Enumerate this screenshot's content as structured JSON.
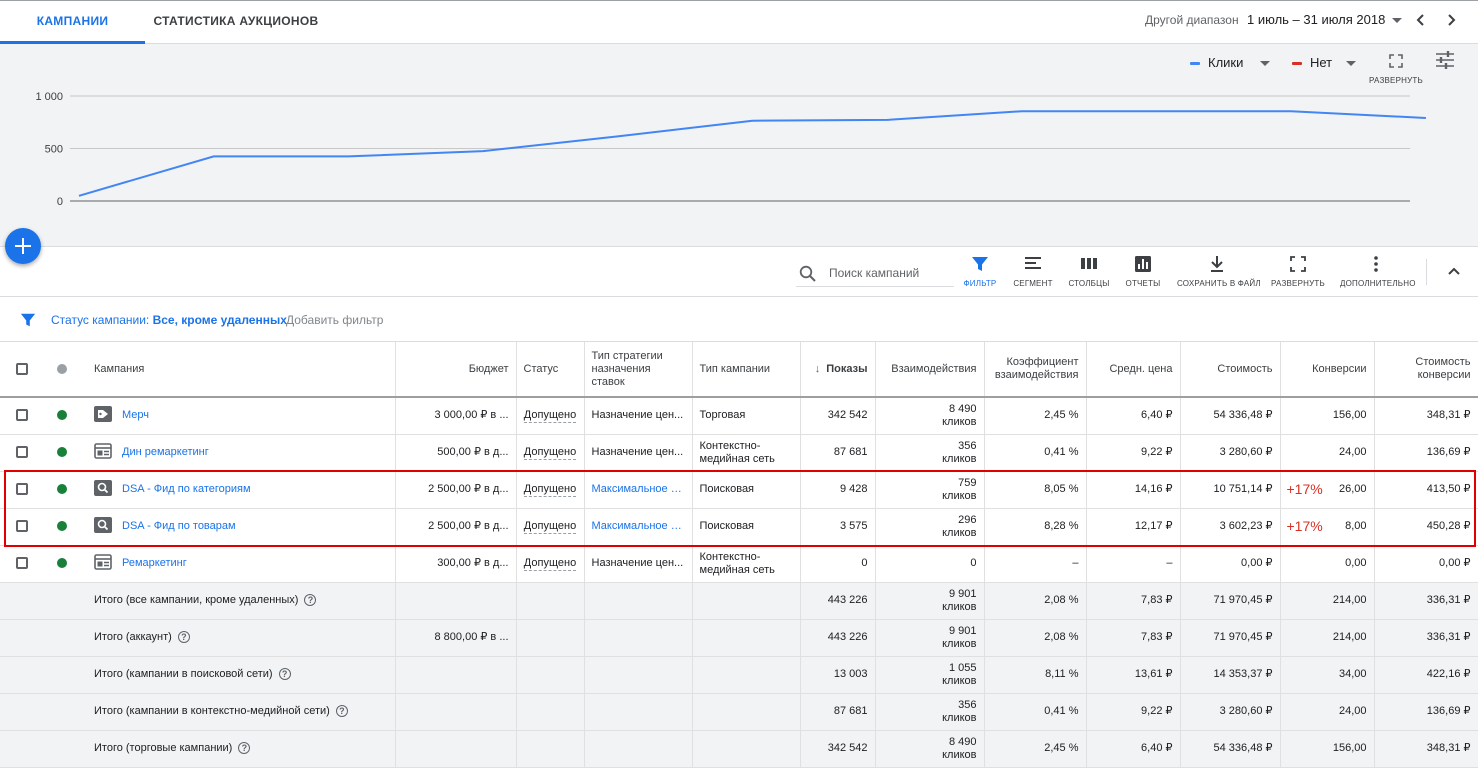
{
  "tabs": [
    {
      "label": "КАМПАНИИ",
      "active": true
    },
    {
      "label": "СТАТИСТИКА АУКЦИОНОВ",
      "active": false
    }
  ],
  "date_range": {
    "label": "Другой диапазон",
    "value": "1 июль – 31 июля 2018"
  },
  "chart_controls": {
    "metric1": {
      "label": "Клики",
      "color": "#4285f4"
    },
    "metric2": {
      "label": "Нет",
      "color": "#d93025"
    },
    "expand_label": "РАЗВЕРНУТЬ"
  },
  "chart_data": {
    "type": "line",
    "series": [
      {
        "values": [
          50,
          425,
          425,
          475,
          615,
          765,
          772,
          855,
          855,
          855,
          790
        ]
      }
    ],
    "y_ticks": [
      "1 000",
      "500",
      "0"
    ],
    "ylim": [
      0,
      1000
    ],
    "grid": true,
    "color": "#4285f4"
  },
  "toolbar": {
    "search_placeholder": "Поиск кампаний",
    "tools": {
      "filter": "ФИЛЬТР",
      "segment": "СЕГМЕНТ",
      "columns": "СТОЛБЦЫ",
      "reports": "ОТЧЕТЫ",
      "download": "СОХРАНИТЬ В ФАЙЛ",
      "expand": "РАЗВЕРНУТЬ",
      "more": "ДОПОЛНИТЕЛЬНО"
    }
  },
  "filter": {
    "prefix": "Статус кампании: ",
    "value": "Все, кроме удаленных",
    "add_label": "Добавить фильтр"
  },
  "table": {
    "headers": {
      "campaign": "Кампания",
      "budget": "Бюджет",
      "status": "Статус",
      "strategy": "Тип стратегии назначения ставок",
      "type": "Тип кампании",
      "impressions": "Показы",
      "interactions": "Взаимодействия",
      "rate": "Коэффициент взаимодействия",
      "avg_cost": "Средн. цена",
      "cost": "Стоимость",
      "conversions": "Конверсии",
      "conv_cost": "Стоимость конверсии"
    },
    "rows": [
      {
        "name": "Мерч",
        "icon": "tag-icon",
        "budget": "3 000,00 ₽ в ...",
        "status": "Допущено",
        "strategy": "Назначение цен...",
        "type": "Торговая",
        "impressions": "342 542",
        "interactions": "8 490",
        "interactions_unit": "кликов",
        "rate": "2,45 %",
        "avg_cost": "6,40 ₽",
        "cost": "54 336,48 ₽",
        "change": "",
        "conversions": "156,00",
        "conv_cost": "348,31 ₽"
      },
      {
        "name": "Дин ремаркетинг",
        "icon": "display-icon",
        "budget": "500,00 ₽ в д...",
        "status": "Допущено",
        "strategy": "Назначение цен...",
        "type": "Контекстно-медийная сеть",
        "impressions": "87 681",
        "interactions": "356",
        "interactions_unit": "кликов",
        "rate": "0,41 %",
        "avg_cost": "9,22 ₽",
        "cost": "3 280,60 ₽",
        "change": "",
        "conversions": "24,00",
        "conv_cost": "136,69 ₽"
      },
      {
        "name": "DSA - Фид по категориям",
        "icon": "search-campaign-icon",
        "budget": "2 500,00 ₽ в д...",
        "status": "Допущено",
        "strategy": "Максимальное к...",
        "type": "Поисковая",
        "impressions": "9 428",
        "interactions": "759",
        "interactions_unit": "кликов",
        "rate": "8,05 %",
        "avg_cost": "14,16 ₽",
        "cost": "10 751,14 ₽",
        "change": "+17%",
        "conversions": "26,00",
        "conv_cost": "413,50 ₽"
      },
      {
        "name": "DSA - Фид по товарам",
        "icon": "search-campaign-icon",
        "budget": "2 500,00 ₽ в д...",
        "status": "Допущено",
        "strategy": "Максимальное к...",
        "type": "Поисковая",
        "impressions": "3 575",
        "interactions": "296",
        "interactions_unit": "кликов",
        "rate": "8,28 %",
        "avg_cost": "12,17 ₽",
        "cost": "3 602,23 ₽",
        "change": "+17%",
        "conversions": "8,00",
        "conv_cost": "450,28 ₽"
      },
      {
        "name": "Ремаркетинг",
        "icon": "display-icon",
        "budget": "300,00 ₽ в д...",
        "status": "Допущено",
        "strategy": "Назначение цен...",
        "type": "Контекстно-медийная сеть",
        "impressions": "0",
        "interactions": "0",
        "interactions_unit": "",
        "rate": "–",
        "avg_cost": "–",
        "cost": "0,00 ₽",
        "change": "",
        "conversions": "0,00",
        "conv_cost": "0,00 ₽"
      }
    ],
    "totals": [
      {
        "label": "Итого (все кампании, кроме удаленных)",
        "budget": "",
        "impressions": "443 226",
        "interactions": "9 901",
        "interactions_unit": "кликов",
        "rate": "2,08 %",
        "avg_cost": "7,83 ₽",
        "cost": "71 970,45 ₽",
        "conversions": "214,00",
        "conv_cost": "336,31 ₽"
      },
      {
        "label": "Итого (аккаунт)",
        "budget": "8 800,00 ₽ в ...",
        "impressions": "443 226",
        "interactions": "9 901",
        "interactions_unit": "кликов",
        "rate": "2,08 %",
        "avg_cost": "7,83 ₽",
        "cost": "71 970,45 ₽",
        "conversions": "214,00",
        "conv_cost": "336,31 ₽"
      },
      {
        "label": "Итого (кампании в поисковой сети)",
        "budget": "",
        "impressions": "13 003",
        "interactions": "1 055",
        "interactions_unit": "кликов",
        "rate": "8,11 %",
        "avg_cost": "13,61 ₽",
        "cost": "14 353,37 ₽",
        "conversions": "34,00",
        "conv_cost": "422,16 ₽"
      },
      {
        "label": "Итого (кампании в контекстно-медийной сети)",
        "budget": "",
        "impressions": "87 681",
        "interactions": "356",
        "interactions_unit": "кликов",
        "rate": "0,41 %",
        "avg_cost": "9,22 ₽",
        "cost": "3 280,60 ₽",
        "conversions": "24,00",
        "conv_cost": "136,69 ₽"
      },
      {
        "label": "Итого (торговые кампании)",
        "budget": "",
        "impressions": "342 542",
        "interactions": "8 490",
        "interactions_unit": "кликов",
        "rate": "2,45 %",
        "avg_cost": "6,40 ₽",
        "cost": "54 336,48 ₽",
        "conversions": "156,00",
        "conv_cost": "348,31 ₽"
      }
    ]
  },
  "colors": {
    "accent": "#1a73e8",
    "enabled": "#188038",
    "highlight": "#e00000",
    "change": "#d93025"
  }
}
